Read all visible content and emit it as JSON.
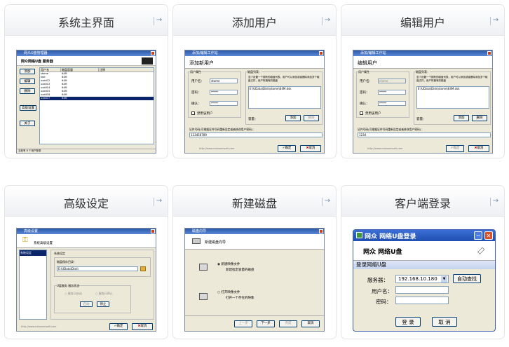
{
  "cards": [
    {
      "title": "系统主界面"
    },
    {
      "title": "添加用户"
    },
    {
      "title": "编辑用户"
    },
    {
      "title": "高级设定"
    },
    {
      "title": "新建磁盘"
    },
    {
      "title": "客户端登录"
    }
  ],
  "main_ui": {
    "window_title": "网众U盘管理器",
    "brand": "网众网络U盘 服务器",
    "buttons": [
      "添加",
      "编辑",
      "删除",
      "高级设置",
      "关于"
    ],
    "columns": [
      "用户名",
      "磁盘容量",
      "注释"
    ],
    "rows": [
      [
        "stome",
        "64M"
      ],
      [
        "test",
        "64M"
      ],
      [
        "uxdd12",
        "64M"
      ],
      [
        "uxdd13",
        "64M"
      ],
      [
        "uxdd14",
        "64M"
      ],
      [
        "uxdd15",
        "64M"
      ],
      [
        "uxdd16",
        "64M"
      ],
      [
        "uxdd17",
        "64M"
      ]
    ],
    "status": "当前有 8 个用户登录"
  },
  "add_user": {
    "window_title": "添加/编辑工作站",
    "header": "添加新用户",
    "user_attr": "用户属性",
    "username_label": "用户名：",
    "username_value": "stome",
    "password_label": "密码：",
    "password_value": "*****",
    "confirm_label": "确认：",
    "confirm_value": "*****",
    "disable_label": "禁用该用户",
    "disk_list_label": "磁盘列表：",
    "disk_hint": "至少设置一个拥有的磁盘列表，用户可以添加或者删除添加多个磁盘文件，用户所拥有的磁盘",
    "disk_path": "E:\\UData\\Disk\\stome\\64M.dsk",
    "capacity_label": "容量：",
    "add_button": "添加",
    "delete_button": "删除",
    "cert_label": "证件号码(可根据证件号码重新设定或者修改用户密码)：",
    "cert_value": "123456789",
    "footer_url": "http://www.netzoomsoft.com",
    "ok_button": "确定",
    "cancel_button": "取消"
  },
  "edit_user": {
    "window_title": "添加/编辑工作站",
    "header": "编辑用户",
    "user_attr": "用户属性",
    "username_label": "用户名：",
    "username_value": "stome",
    "password_label": "密码：",
    "password_value": "*****",
    "confirm_label": "确认：",
    "confirm_value": "*****",
    "disable_label": "禁用该用户",
    "disk_list_label": "磁盘列表：",
    "disk_hint": "至少设置一个拥有的磁盘列表，用户可以添加或者删除添加多个磁盘文件，用户所拥有的磁盘",
    "disk_path": "E:\\UData\\Disk\\stome\\64M.dsk",
    "capacity_label": "容量：",
    "add_button": "添加",
    "delete_button": "删除",
    "cert_label": "证件号码(可根据证件号码重新设定或者修改用户密码)：",
    "cert_value": "1234",
    "footer_url": "http://www.netzoomsoft.com",
    "ok_button": "确定",
    "cancel_button": "取消"
  },
  "advanced": {
    "window_title": "高级设置",
    "header": "系统高级设置",
    "nav_item": "系统设定",
    "group": "系统设定",
    "path_label": "磁盘保存目录：",
    "path_value": "E:\\UData\\Disk\\",
    "service_group": "U盘服务 服务状态",
    "running": "服务已启动",
    "stopped": "服务已停止",
    "start_button": "启动",
    "stop_button": "停止",
    "footer_url": "http://www.netzoomsoft.com",
    "ok_button": "确定",
    "cancel_button": "取消"
  },
  "new_disk": {
    "window_title": "磁盘向导",
    "header": "新建磁盘向导",
    "opt1_title": "新建映像文件",
    "opt1_desc": "新建指定容量的磁盘",
    "opt2_title": "打开映像文件",
    "opt2_desc": "打开一个存在的映象",
    "back_button": "上一步",
    "next_button": "下一步",
    "finish_button": "完成",
    "cancel_button": "取消"
  },
  "client_login": {
    "window_title": "网众 网络U盘登录",
    "brand": "网众 网络U盘",
    "section": "登录网络U盘",
    "server_label": "服务器：",
    "server_value": "192.168.10.180",
    "auto_find_button": "自动查找",
    "username_label": "用户名：",
    "password_label": "密码：",
    "login_button": "登 录",
    "cancel_button": "取 消"
  }
}
